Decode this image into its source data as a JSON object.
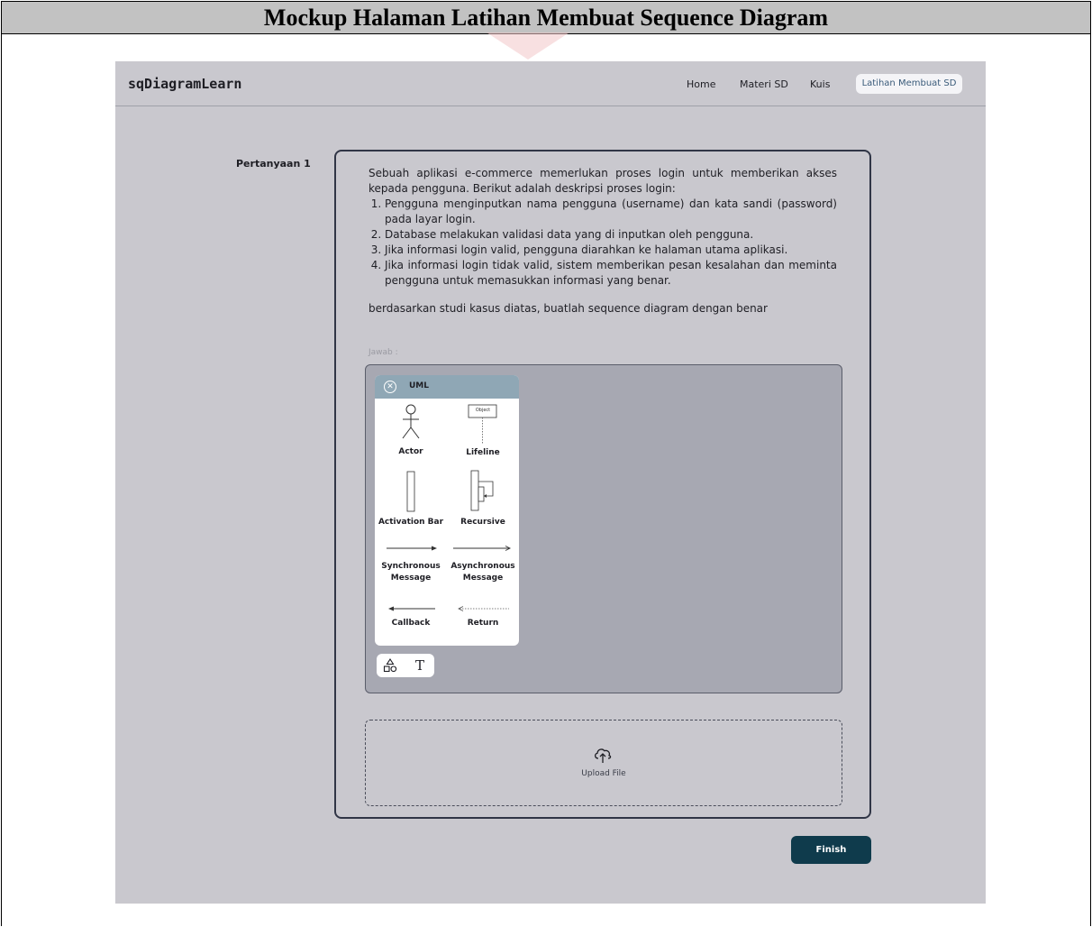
{
  "caption": "Mockup Halaman Latihan Membuat Sequence Diagram",
  "navbar": {
    "brand": "sqDiagramLearn",
    "links": [
      "Home",
      "Materi SD",
      "Kuis"
    ],
    "active_link": "Latihan Membuat SD"
  },
  "question": {
    "label": "Pertanyaan 1",
    "intro": "Sebuah aplikasi e-commerce memerlukan proses login untuk memberikan akses kepada pengguna. Berikut adalah deskripsi proses login:",
    "steps": [
      "Pengguna menginputkan nama pengguna (username) dan kata sandi (password) pada layar login.",
      "Database melakukan validasi data yang di inputkan oleh pengguna.",
      "Jika informasi login valid, pengguna diarahkan ke halaman utama aplikasi.",
      "Jika informasi login tidak valid, sistem memberikan pesan kesalahan dan meminta pengguna untuk memasukkan informasi yang benar."
    ],
    "instruction": "berdasarkan studi kasus diatas, buatlah  sequence diagram dengan  benar"
  },
  "answer": {
    "label": "Jawab :"
  },
  "uml_panel": {
    "title": "UML",
    "object_label": "Object",
    "items": {
      "actor": "Actor",
      "lifeline": "Lifeline",
      "activation_bar": "Activation Bar",
      "recursive": "Recursive",
      "sync_message": [
        "Synchronous",
        "Message"
      ],
      "async_message": [
        "Asynchronous",
        "Message"
      ],
      "callback": "Callback",
      "return": "Return"
    }
  },
  "toolbar": {
    "shapes_icon": "shapes-icon",
    "text_icon": "text-tool-icon",
    "text_glyph": "T"
  },
  "upload": {
    "label": "Upload File",
    "icon": "cloud-upload-icon"
  },
  "finish_label": "Finish",
  "colors": {
    "canvas": "#c9c8ce",
    "card_border": "#303546",
    "answer_bg": "#a7a8b2",
    "uml_header": "#8fa7b5",
    "finish_bg": "#0f3b4c",
    "active_link_text": "#3a5b7a"
  }
}
